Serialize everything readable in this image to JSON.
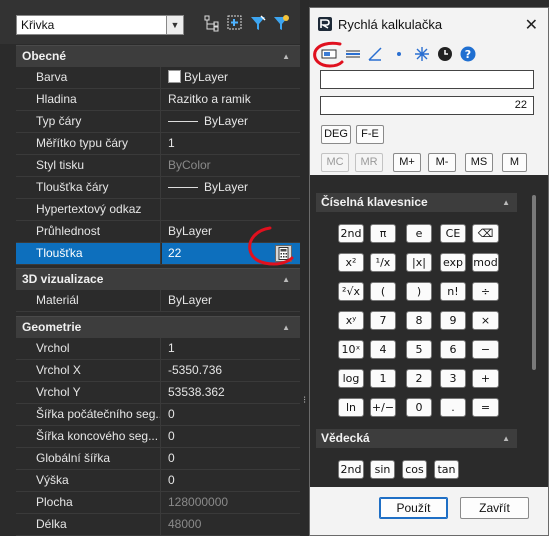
{
  "props": {
    "object_type": "Křivka",
    "sections": {
      "general": "Obecné",
      "vis3d": "3D vizualizace",
      "geometry": "Geometrie"
    },
    "general_rows": [
      {
        "key": "Barva",
        "value": "ByLayer"
      },
      {
        "key": "Hladina",
        "value": "Razitko a ramik"
      },
      {
        "key": "Typ čáry",
        "value": "ByLayer"
      },
      {
        "key": "Měřítko typu čáry",
        "value": "1"
      },
      {
        "key": "Styl tisku",
        "value": "ByColor"
      },
      {
        "key": "Tloušťka čáry",
        "value": "ByLayer"
      },
      {
        "key": "Hypertextový odkaz",
        "value": ""
      },
      {
        "key": "Průhlednost",
        "value": "ByLayer"
      },
      {
        "key": "Tloušťka",
        "value": "22"
      }
    ],
    "vis3d_rows": [
      {
        "key": "Materiál",
        "value": "ByLayer"
      }
    ],
    "geometry_rows": [
      {
        "key": "Vrchol",
        "value": "1"
      },
      {
        "key": "Vrchol X",
        "value": "-5350.736"
      },
      {
        "key": "Vrchol Y",
        "value": "53538.362"
      },
      {
        "key": "Šířka počátečního seg...",
        "value": "0"
      },
      {
        "key": "Šířka koncového seg...",
        "value": "0"
      },
      {
        "key": "Globální šířka",
        "value": "0"
      },
      {
        "key": "Výška",
        "value": "0"
      },
      {
        "key": "Plocha",
        "value": "128000000"
      },
      {
        "key": "Délka",
        "value": "48000"
      }
    ]
  },
  "calc": {
    "title": "Rychlá kalkulačka",
    "input_value": "",
    "display_value": "22",
    "mode_buttons": [
      "DEG",
      "F-E"
    ],
    "memory_buttons": [
      "MC",
      "MR",
      "M+",
      "M-",
      "MS",
      "M"
    ],
    "keypad_section": "Číselná klavesnice",
    "scientific_section": "Vědecká",
    "keypad": [
      [
        "2nd",
        "π",
        "e",
        "CE",
        "⌫"
      ],
      [
        "x²",
        "¹/x",
        "|x|",
        "exp",
        "mod"
      ],
      [
        "²√x",
        "(",
        ")",
        "n!",
        "÷"
      ],
      [
        "xʸ",
        "7",
        "8",
        "9",
        "×"
      ],
      [
        "10ˣ",
        "4",
        "5",
        "6",
        "−"
      ],
      [
        "log",
        "1",
        "2",
        "3",
        "+"
      ],
      [
        "ln",
        "+/−",
        "0",
        ".",
        "="
      ]
    ],
    "scientific": [
      "2nd",
      "sin",
      "cos",
      "tan"
    ],
    "apply_label": "Použít",
    "close_label": "Zavřít"
  },
  "colors": {
    "selection": "#0d6fbd",
    "annotation": "#e0101e",
    "panel_bg": "#2b2b2b"
  }
}
